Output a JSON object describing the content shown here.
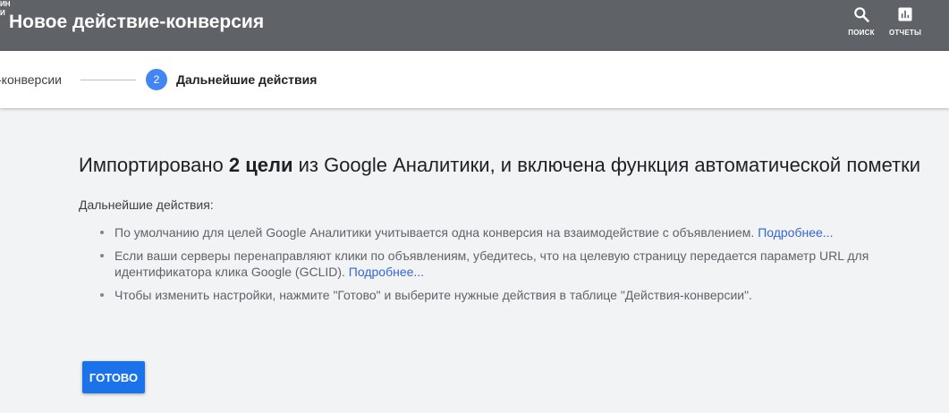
{
  "header": {
    "title": "Новое действие-конверсия",
    "tools": {
      "search_label": "ПОИСК",
      "reports_label": "ОТЧЕТЫ",
      "more_label_line1": "ИН",
      "more_label_line2": "И"
    },
    "background_color": "#5f6368"
  },
  "stepper": {
    "previous_step_label": "-конверсии",
    "current_step_number": "2",
    "current_step_label": "Дальнейшие действия",
    "accent_color": "#4285f4"
  },
  "main": {
    "headline_pre": "Импортировано ",
    "headline_bold": "2 цели",
    "headline_post": " из Google Аналитики, и включена функция автоматической пометки",
    "subheading": "Дальнейшие действия:",
    "bullets": [
      {
        "text": "По умолчанию для целей Google Аналитики учитывается одна конверсия на взаимодействие с объявлением. ",
        "link": "Подробнее..."
      },
      {
        "text": "Если ваши серверы перенаправляют клики по объявлениям, убедитесь, что на целевую страницу передается параметр URL для идентификатора клика Google (GCLID). ",
        "link": "Подробнее..."
      },
      {
        "text": "Чтобы изменить настройки, нажмите \"Готово\" и выберите нужные действия в таблице \"Действия-конверсии\".",
        "link": ""
      }
    ],
    "link_color": "#3367d6"
  },
  "actions": {
    "done_label": "ГОТОВО",
    "button_color": "#1a73e8"
  },
  "icons": {
    "search": "search-icon",
    "reports": "bar-chart-icon"
  }
}
